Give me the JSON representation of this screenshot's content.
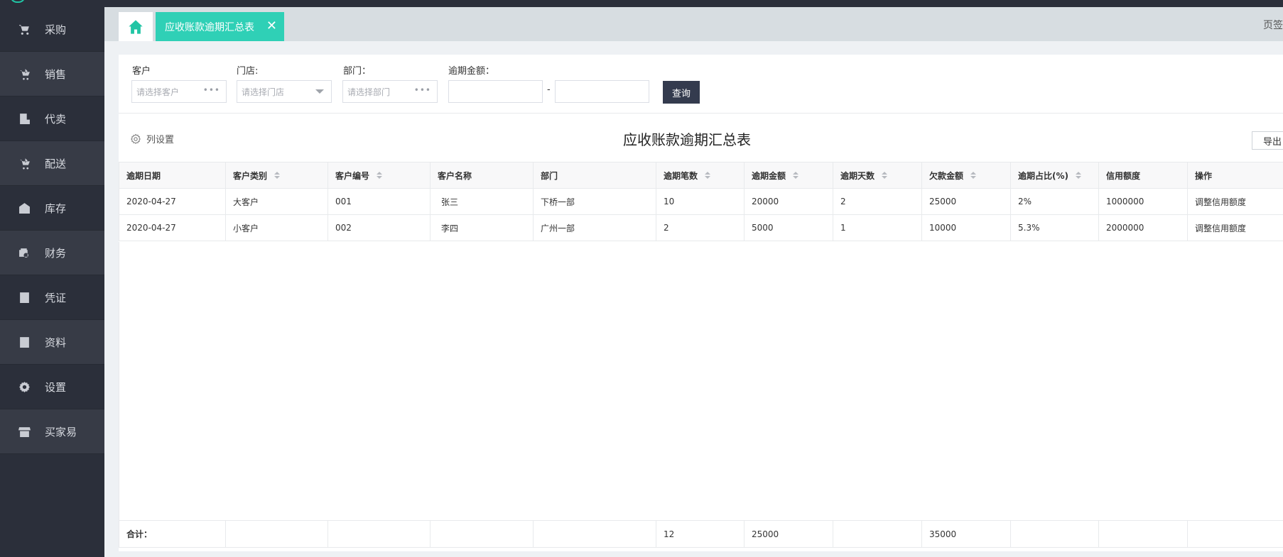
{
  "sidebar": {
    "items": [
      {
        "label": "采购",
        "icon": "cart-icon"
      },
      {
        "label": "销售",
        "icon": "sale-cart-icon"
      },
      {
        "label": "代卖",
        "icon": "consign-icon"
      },
      {
        "label": "配送",
        "icon": "delivery-icon"
      },
      {
        "label": "库存",
        "icon": "warehouse-icon"
      },
      {
        "label": "财务",
        "icon": "finance-icon"
      },
      {
        "label": "凭证",
        "icon": "voucher-icon"
      },
      {
        "label": "资料",
        "icon": "data-icon"
      },
      {
        "label": "设置",
        "icon": "gear-icon"
      },
      {
        "label": "买家易",
        "icon": "store-icon"
      }
    ]
  },
  "tabs": {
    "active_label": "应收账款逾期汇总表",
    "close_symbol": "✕",
    "right_label": "页签"
  },
  "filters": {
    "customer_label": "客户",
    "customer_placeholder": "请选择客户",
    "store_label": "门店:",
    "store_placeholder": "请选择门店",
    "dept_label": "部门：",
    "dept_placeholder": "请选择部门",
    "amount_label": "逾期金额：",
    "range_separator": "-",
    "query_button": "查询",
    "more_symbol": "•••"
  },
  "toolbar": {
    "column_settings": "列设置",
    "title": "应收账款逾期汇总表",
    "export": "导出"
  },
  "table": {
    "headers": [
      "逾期日期",
      "客户类别",
      "客户编号",
      "客户名称",
      "部门",
      "逾期笔数",
      "逾期金额",
      "逾期天数",
      "欠款金额",
      "逾期占比(%)",
      "信用额度",
      "操作"
    ],
    "rows": [
      [
        "2020-04-27",
        "大客户",
        "001",
        "张三",
        "下桥一部",
        "10",
        "20000",
        "2",
        "25000",
        "2%",
        "1000000",
        "调整信用额度"
      ],
      [
        "2020-04-27",
        "小客户",
        "002",
        "李四",
        "广州一部",
        "2",
        "5000",
        "1",
        "10000",
        "5.3%",
        "2000000",
        "调整信用额度"
      ]
    ],
    "totals": {
      "label": "合计：",
      "count": "12",
      "amount": "25000",
      "debt": "35000"
    }
  },
  "colors": {
    "accent": "#2fd0b6",
    "sidebar_bg": "#2b2f3a",
    "button_dark": "#343b4e"
  }
}
